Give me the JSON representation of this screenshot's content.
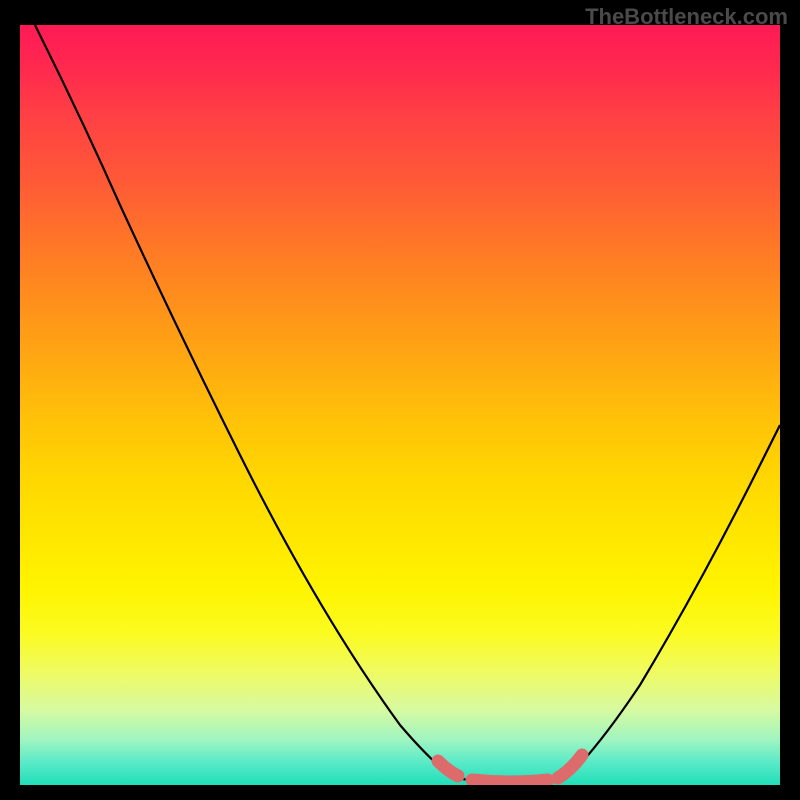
{
  "watermark": "TheBottleneck.com",
  "chart_data": {
    "type": "line",
    "title": "",
    "xlabel": "",
    "ylabel": "",
    "xlim": [
      0,
      100
    ],
    "ylim": [
      0,
      100
    ],
    "series": [
      {
        "name": "curve-left",
        "x": [
          2,
          10,
          20,
          30,
          40,
          50,
          55,
          58
        ],
        "y": [
          100,
          84,
          64,
          44,
          25,
          8,
          2,
          0
        ]
      },
      {
        "name": "curve-right",
        "x": [
          72,
          76,
          82,
          88,
          94,
          100
        ],
        "y": [
          0,
          4,
          12,
          22,
          33,
          45
        ]
      },
      {
        "name": "flat-zone",
        "x": [
          58,
          60,
          64,
          68,
          70,
          72
        ],
        "y": [
          0,
          0,
          0,
          0,
          0,
          0
        ]
      }
    ],
    "highlight": {
      "name": "optimal-zone",
      "color": "#dd6b6b",
      "segments": [
        {
          "x": [
            55.5,
            57
          ],
          "y": [
            2.5,
            1.2
          ]
        },
        {
          "x": [
            59,
            70
          ],
          "y": [
            0.3,
            0.3
          ]
        },
        {
          "x": [
            70,
            72.5
          ],
          "y": [
            0.8,
            2.8
          ]
        }
      ]
    },
    "gradient_stops": [
      {
        "pos": 0,
        "color": "#ff1a56"
      },
      {
        "pos": 50,
        "color": "#ffc800"
      },
      {
        "pos": 80,
        "color": "#fff200"
      },
      {
        "pos": 100,
        "color": "#20dfb8"
      }
    ]
  }
}
